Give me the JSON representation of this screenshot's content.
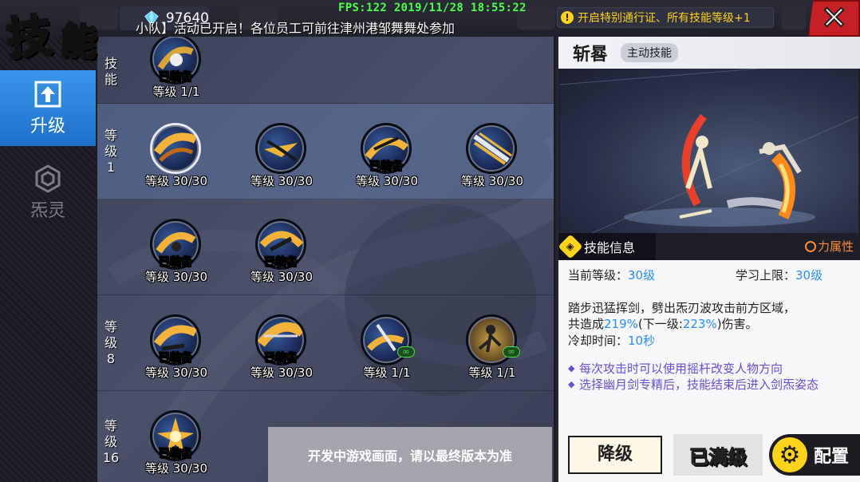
{
  "header": {
    "title": [
      "技",
      "能"
    ],
    "crystal_count": "97640",
    "fps_text": "FPS:122  2019/11/28 18:55:22",
    "notice_text": "开启特别通行证、所有技能等级+1",
    "close_icon": "close-x-icon"
  },
  "nav": {
    "tabs": [
      {
        "label": "升级",
        "icon": "upgrade-arrow-icon",
        "active": true
      },
      {
        "label": "炁灵",
        "icon": "hexagon-spirit-icon",
        "active": false
      }
    ]
  },
  "marquee": "小队】活动已开启！各位员工可前往津州港邹舞舞处参加",
  "grid": {
    "rows": [
      {
        "label_lines": [
          "技",
          "能"
        ],
        "skills": [
          {
            "equipped": "已装备",
            "level": "等级 1/1"
          }
        ]
      },
      {
        "label_lines": [
          "等",
          "级",
          "1"
        ],
        "skills": [
          {
            "equipped": "",
            "level": "等级 30/30",
            "selected": true
          },
          {
            "equipped": "",
            "level": "等级 30/30"
          },
          {
            "equipped": "已装备",
            "level": "等级 30/30"
          },
          {
            "equipped": "",
            "level": "等级 30/30"
          }
        ]
      },
      {
        "label_lines": [],
        "skills": [
          {
            "equipped": "已装备",
            "level": "等级 30/30"
          },
          {
            "equipped": "已装备",
            "level": "等级 30/30"
          }
        ]
      },
      {
        "label_lines": [
          "等",
          "级",
          "8"
        ],
        "skills": [
          {
            "equipped": "已装备",
            "level": "等级 30/30"
          },
          {
            "equipped": "已装备",
            "level": "等级 30/30"
          },
          {
            "equipped": "",
            "level": "等级 1/1",
            "infinite": true
          },
          {
            "equipped": "",
            "level": "等级 1/1",
            "infinite": true
          }
        ]
      },
      {
        "label_lines": [
          "等",
          "级",
          "16"
        ],
        "skills": [
          {
            "equipped": "已装备",
            "level": "等级 30/30"
          }
        ]
      }
    ]
  },
  "detail": {
    "skill_name": "斩晷",
    "skill_type": "主动技能",
    "info_title": "技能信息",
    "attr_label": "力属性",
    "current_level_label": "当前等级：",
    "current_level_value": "30级",
    "max_level_label": "学习上限：",
    "max_level_value": "30级",
    "desc_line1": "踏步迅猛挥剑，劈出炁刃波攻击前方区域，",
    "desc_line2_prefix": "共造成",
    "desc_pct": "219%",
    "desc_mid": "(下一级:",
    "desc_next": "223%",
    "desc_suffix": ")伤害。",
    "cooldown_label": "冷却时间：",
    "cooldown_value": "10秒",
    "tips": [
      "每次攻击时可以使用摇杆改变人物方向",
      "选择幽月剑专精后，技能结束后进入剑炁姿态"
    ]
  },
  "buttons": {
    "downgrade": "降级",
    "maxed": "已满级",
    "config": "配置"
  },
  "dev_note": "开发中游戏画面，请以最终版本为准",
  "colors": {
    "accent_yellow": "#ffd21c",
    "active_tab_blue": "#2a82dc",
    "value_blue": "#2a8ef0",
    "tip_purple": "#6a4fd0",
    "close_red": "#c61f24"
  }
}
